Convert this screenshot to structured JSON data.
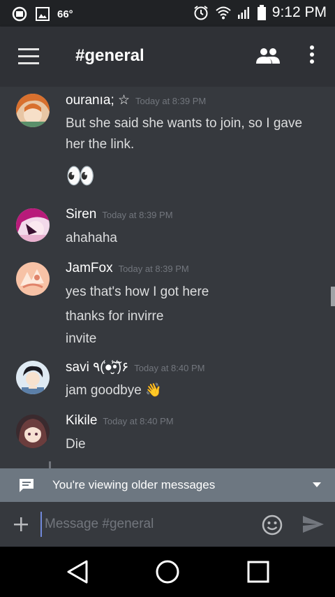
{
  "status_bar": {
    "temperature": "66°",
    "time": "9:12 PM"
  },
  "toolbar": {
    "channel_title": "#general"
  },
  "messages": [
    {
      "username": "ouranıa; ☆",
      "timestamp": "Today at 8:39 PM",
      "lines": [
        "But she said she wants to join, so I gave",
        "her the link.",
        "👀"
      ]
    },
    {
      "username": "Siren",
      "timestamp": "Today at 8:39 PM",
      "lines": [
        "ahahaha"
      ]
    },
    {
      "username": "JamFox",
      "timestamp": "Today at 8:39 PM",
      "lines": [
        "yes that's how I got here",
        "thanks for invirre",
        "invite"
      ]
    },
    {
      "username": "savi ٩(̾●̮̮̃̾•̃̾)۶",
      "timestamp": "Today at 8:40 PM",
      "lines": [
        "jam goodbye 👋"
      ]
    },
    {
      "username": "Kikile",
      "timestamp": "Today at 8:40 PM",
      "lines": [
        "Die"
      ]
    }
  ],
  "older_banner": {
    "text": "You're viewing older messages"
  },
  "composer": {
    "placeholder": "Message #general"
  },
  "colors": {
    "background": "#36393e",
    "toolbar": "#2f3136",
    "accent": "#7289da",
    "banner": "#6d7781"
  },
  "icons": [
    "alarm-icon",
    "image-icon",
    "clock-icon",
    "wifi-icon",
    "signal-icon",
    "battery-icon",
    "menu-icon",
    "members-icon",
    "more-icon",
    "chat-bubble-icon",
    "chevron-down-icon",
    "plus-icon",
    "emoji-icon",
    "send-icon",
    "back-icon",
    "home-icon",
    "recents-icon"
  ]
}
